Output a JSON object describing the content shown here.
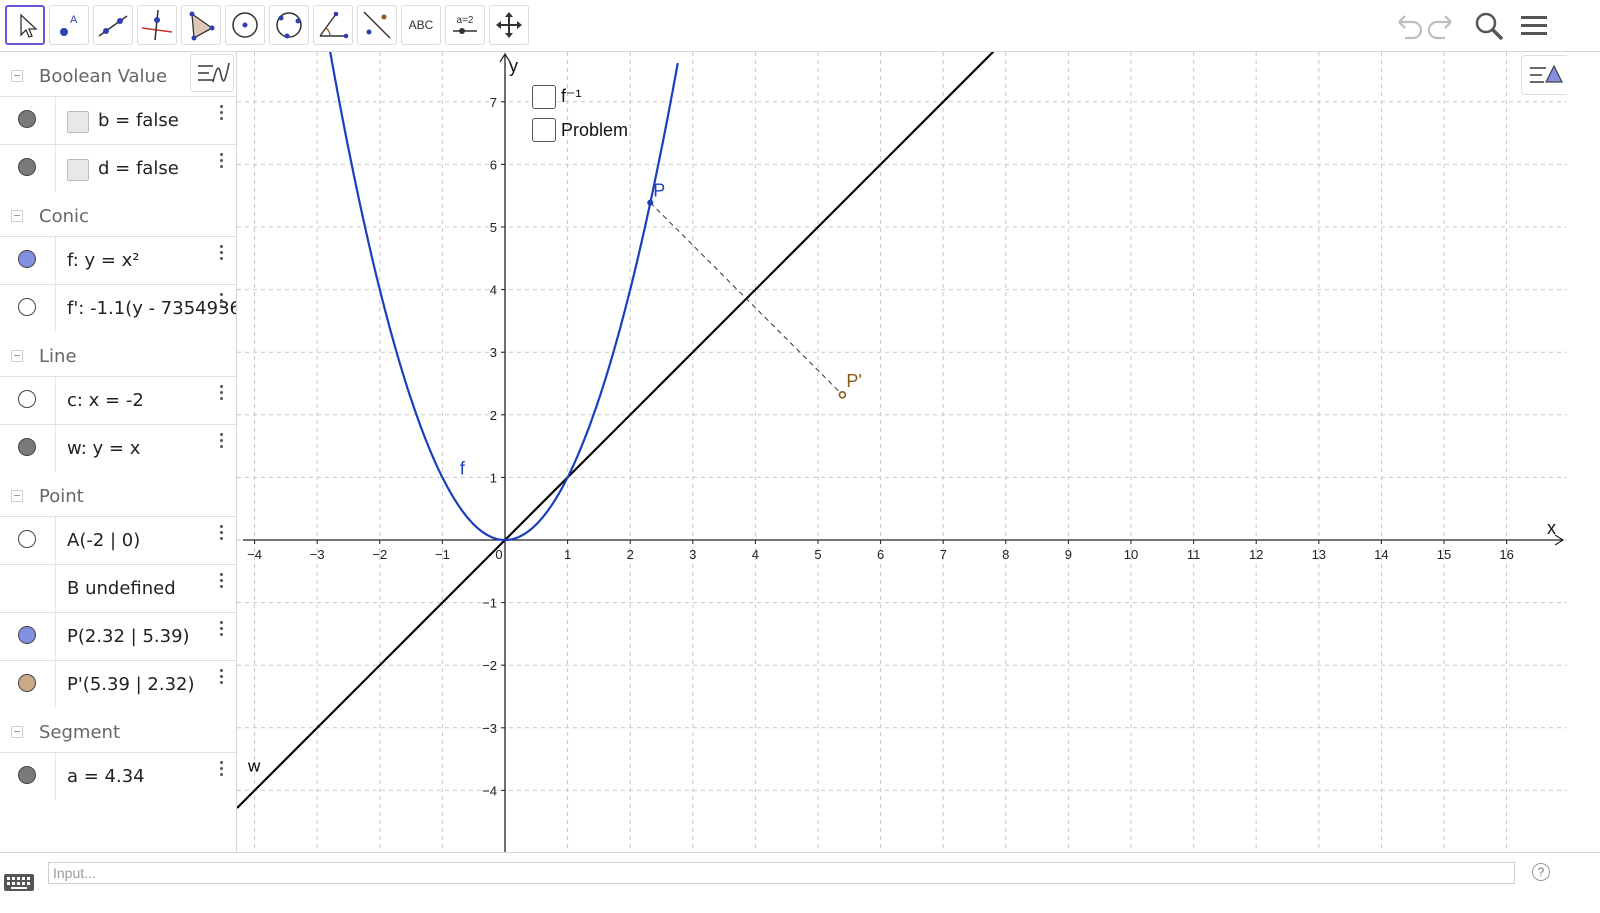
{
  "toolbar": {
    "tools": [
      {
        "name": "move-tool",
        "label": ""
      },
      {
        "name": "point-tool",
        "label": ""
      },
      {
        "name": "line-tool",
        "label": ""
      },
      {
        "name": "perpendicular-line-tool",
        "label": ""
      },
      {
        "name": "polygon-tool",
        "label": ""
      },
      {
        "name": "circle-center-point-tool",
        "label": ""
      },
      {
        "name": "circle-three-points-tool",
        "label": ""
      },
      {
        "name": "angle-tool",
        "label": ""
      },
      {
        "name": "reflect-tool",
        "label": ""
      },
      {
        "name": "text-tool",
        "label": "ABC"
      },
      {
        "name": "slider-tool",
        "label": "a=2"
      },
      {
        "name": "move-graphics-tool",
        "label": ""
      }
    ],
    "right_icons": [
      "undo-icon",
      "redo-icon",
      "search-icon",
      "menu-icon"
    ]
  },
  "algebra": {
    "groups": [
      {
        "title": "Boolean Value",
        "items": [
          {
            "text": "b = false",
            "checkbox": true,
            "dot": "#7a7a7a"
          },
          {
            "text": "d = false",
            "checkbox": true,
            "dot": "#7a7a7a"
          }
        ]
      },
      {
        "title": "Conic",
        "items": [
          {
            "text": "f: y = x²",
            "dot": "#8190e0"
          },
          {
            "text": "f': -1.1(y - 7354936",
            "dot": "#ffffff"
          }
        ]
      },
      {
        "title": "Line",
        "items": [
          {
            "text": "c: x = -2",
            "dot": "#ffffff"
          },
          {
            "text": "w: y = x",
            "dot": "#7a7a7a"
          }
        ]
      },
      {
        "title": "Point",
        "items": [
          {
            "text": "A(-2 | 0)",
            "dot": "#ffffff"
          },
          {
            "text": "B undefined",
            "dot": null
          },
          {
            "text": "P(2.32 | 5.39)",
            "dot": "#8190e0"
          },
          {
            "text": "P'(5.39 | 2.32)",
            "dot": "#c9a988"
          }
        ]
      },
      {
        "title": "Segment",
        "items": [
          {
            "text": "a = 4.34",
            "dot": "#7a7a7a"
          }
        ]
      }
    ]
  },
  "graphics": {
    "x_ticks": [
      "−4",
      "−3",
      "−2",
      "−1",
      "0",
      "1",
      "2",
      "3",
      "4",
      "5",
      "6",
      "7",
      "8",
      "9",
      "10",
      "11",
      "12",
      "13",
      "14",
      "15",
      "16"
    ],
    "y_ticks": [
      "−4",
      "−3",
      "−2",
      "−1",
      "1",
      "2",
      "3",
      "4",
      "5",
      "6",
      "7"
    ],
    "x_axis_label": "x",
    "y_axis_label": "y",
    "labels": {
      "f": "f",
      "P": "P",
      "P_prime": "P'",
      "w": "w"
    },
    "point_P": [
      2.32,
      5.39
    ],
    "point_P_prime": [
      5.39,
      2.32
    ],
    "checkboxes": [
      {
        "label": "f⁻¹",
        "checked": false
      },
      {
        "label": "Problem",
        "checked": false
      }
    ],
    "colors": {
      "function": "#1b3fbb",
      "line": "#000000",
      "P": "#1b3fbb",
      "P_prime": "#8a5c1c",
      "grid": "#c8c8c8"
    }
  },
  "input": {
    "placeholder": "Input..."
  },
  "help_label": "?"
}
